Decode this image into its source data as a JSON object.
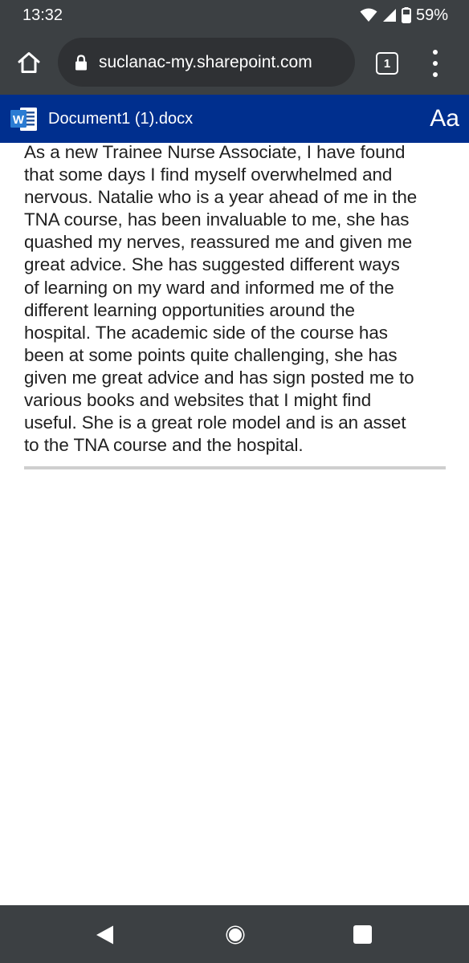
{
  "status_bar": {
    "time": "13:32",
    "battery": "59%",
    "icons": [
      "wifi-icon",
      "cell-signal-icon",
      "battery-icon"
    ]
  },
  "browser": {
    "url": "suclanac-my.sharepoint.com",
    "tab_count": "1",
    "icons": [
      "home-icon",
      "lock-icon",
      "tabs-icon",
      "overflow-menu-icon"
    ]
  },
  "word": {
    "logo_letter": "W",
    "document_title": "Document1 (1).docx",
    "font_button": "Aa",
    "header_color": "#002f8e"
  },
  "document": {
    "lines": [
      "As a new Trainee Nurse Associate, I have found",
      "that some days I find myself overwhelmed and",
      "nervous. Natalie who is a year ahead of me in the",
      "TNA course, has been invaluable to me, she has",
      "quashed my nerves, reassured me and given me",
      "great advice. She has suggested different ways",
      "of learning on my ward and informed me of the",
      "different learning opportunities around the",
      "hospital. The academic side of the course has",
      "been at some points quite challenging, she has",
      "given me great advice and has sign posted me to",
      "various books and websites that I might find",
      "useful. She is a great role model and is an asset",
      "to the TNA course and the hospital."
    ]
  },
  "nav_bar": {
    "icons": [
      "back-icon",
      "home-circle-icon",
      "recents-icon"
    ]
  }
}
